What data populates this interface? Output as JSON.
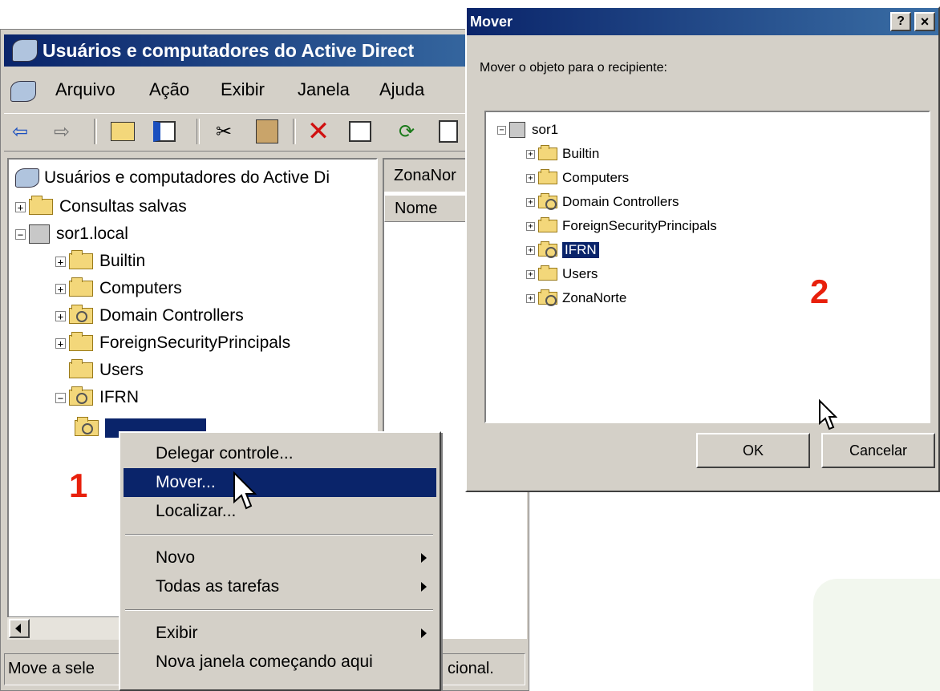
{
  "main_window": {
    "title": "Usuários e computadores do Active Direct",
    "menu": [
      "Arquivo",
      "Ação",
      "Exibir",
      "Janela",
      "Ajuda"
    ],
    "toolbar_icons": [
      "back-arrow-icon",
      "forward-arrow-icon",
      "up-folder-icon",
      "show-tree-icon",
      "cut-icon",
      "paste-icon",
      "delete-icon",
      "properties-icon",
      "refresh-icon",
      "export-icon"
    ],
    "tree_root": "Usuários e computadores do Active Di",
    "tree": [
      {
        "label": "Consultas salvas",
        "exp": "+",
        "indent": 0,
        "icon": "folder"
      },
      {
        "label": "sor1.local",
        "exp": "−",
        "indent": 0,
        "icon": "server"
      },
      {
        "label": "Builtin",
        "exp": "+",
        "indent": 1,
        "icon": "folder"
      },
      {
        "label": "Computers",
        "exp": "+",
        "indent": 1,
        "icon": "folder"
      },
      {
        "label": "Domain Controllers",
        "exp": "+",
        "indent": 1,
        "icon": "ou"
      },
      {
        "label": "ForeignSecurityPrincipals",
        "exp": "+",
        "indent": 1,
        "icon": "folder"
      },
      {
        "label": "Users",
        "exp": "",
        "indent": 1,
        "icon": "folder"
      },
      {
        "label": "IFRN",
        "exp": "−",
        "indent": 1,
        "icon": "ou"
      }
    ],
    "right_tab": "ZonaNor",
    "column_header": "Nome",
    "status_left": "Move a sele",
    "status_right": "cional."
  },
  "context_menu": {
    "items": [
      {
        "label": "Delegar controle...",
        "submenu": false
      },
      {
        "label": "Mover...",
        "submenu": false,
        "highlighted": true
      },
      {
        "label": "Localizar...",
        "submenu": false
      },
      {
        "label": "Novo",
        "submenu": true
      },
      {
        "label": "Todas as tarefas",
        "submenu": true
      },
      {
        "label": "Exibir",
        "submenu": true
      },
      {
        "label": "Nova janela começando aqui",
        "submenu": false
      }
    ]
  },
  "move_dialog": {
    "title": "Mover",
    "help_button": "?",
    "close_button": "×",
    "prompt": "Mover o objeto para o recipiente:",
    "root": "sor1",
    "tree": [
      {
        "label": "Builtin",
        "icon": "folder"
      },
      {
        "label": "Computers",
        "icon": "folder"
      },
      {
        "label": "Domain Controllers",
        "icon": "ou"
      },
      {
        "label": "ForeignSecurityPrincipals",
        "icon": "folder"
      },
      {
        "label": "IFRN",
        "icon": "ou",
        "selected": true
      },
      {
        "label": "Users",
        "icon": "folder"
      },
      {
        "label": "ZonaNorte",
        "icon": "ou"
      }
    ],
    "ok_label": "OK",
    "cancel_label": "Cancelar"
  },
  "step_labels": {
    "step1": "1",
    "step2": "2"
  },
  "colors": {
    "title_bar": "#0a246a",
    "selection": "#0a246a",
    "face": "#d4d0c8",
    "step_number": "#e8200c"
  }
}
